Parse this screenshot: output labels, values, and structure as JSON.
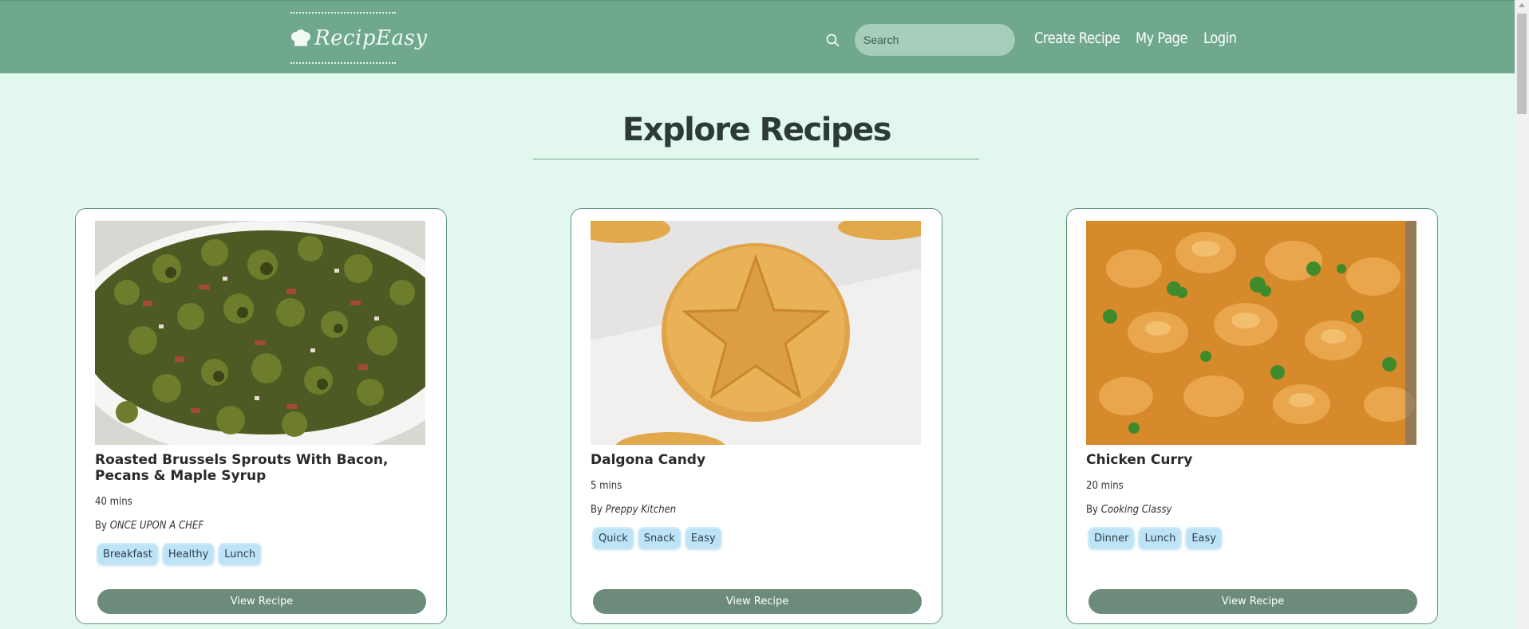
{
  "header": {
    "logo_text": "RecipEasy",
    "search_placeholder": "Search",
    "nav": [
      "Create Recipe",
      "My Page",
      "Login"
    ]
  },
  "page": {
    "title": "Explore Recipes"
  },
  "recipes": [
    {
      "title": "Roasted Brussels Sprouts With Bacon, Pecans & Maple Syrup",
      "time": "40 mins",
      "by_label": "By",
      "author": "ONCE UPON A CHEF",
      "tags": [
        "Breakfast",
        "Healthy",
        "Lunch"
      ],
      "button": "View Recipe",
      "image": "brussels-sprouts-photo"
    },
    {
      "title": "Dalgona Candy",
      "time": "5 mins",
      "by_label": "By",
      "author": "Preppy Kitchen",
      "tags": [
        "Quick",
        "Snack",
        "Easy"
      ],
      "button": "View Recipe",
      "image": "dalgona-candy-photo"
    },
    {
      "title": "Chicken Curry",
      "time": "20 mins",
      "by_label": "By",
      "author": "Cooking Classy",
      "tags": [
        "Dinner",
        "Lunch",
        "Easy"
      ],
      "button": "View Recipe",
      "image": "chicken-curry-photo"
    }
  ],
  "colors": {
    "header_bg": "#70a88d",
    "page_bg": "#e2f8ee",
    "button_bg": "#6c8b7a",
    "tag_bg": "#bde3f7"
  }
}
